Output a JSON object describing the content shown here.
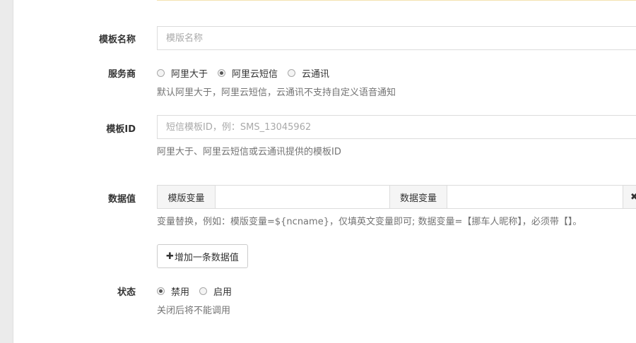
{
  "form": {
    "template_name": {
      "label": "模板名称",
      "placeholder": "模版名称",
      "value": ""
    },
    "provider": {
      "label": "服务商",
      "options": [
        "阿里大于",
        "阿里云短信",
        "云通讯"
      ],
      "selected": "阿里云短信",
      "help": "默认阿里大于，阿里云短信，云通讯不支持自定义语音通知"
    },
    "template_id": {
      "label": "模板ID",
      "placeholder": "短信模板ID，例：SMS_13045962",
      "value": "",
      "help": "阿里大于、阿里云短信或云通讯提供的模板ID"
    },
    "data_values": {
      "label": "数据值",
      "row": {
        "template_var_label": "模版变量",
        "template_var_value": "",
        "data_var_label": "数据变量",
        "data_var_value": "",
        "remove_glyph": "✖"
      },
      "help": "变量替换，例如：模版变量=${ncname}，仅填英文变量即可; 数据变量=【挪车人昵称】，必须带【】。",
      "add_button": {
        "icon": "plus-icon",
        "glyph": "✚",
        "label": "增加一条数据值"
      }
    },
    "status": {
      "label": "状态",
      "options": [
        "禁用",
        "启用"
      ],
      "selected": "禁用",
      "help": "关闭后将不能调用"
    }
  },
  "colors": {
    "alert_bg": "#fcf8e3",
    "input_border": "#dcdcdc",
    "help_text": "#737373",
    "addon_bg": "#f5f5f5"
  }
}
